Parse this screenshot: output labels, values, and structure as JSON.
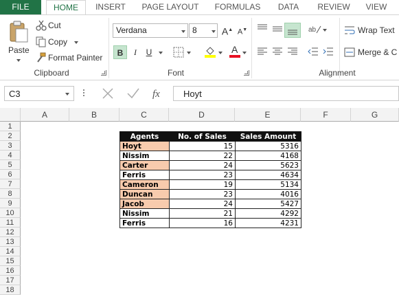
{
  "tabs": [
    "FILE",
    "HOME",
    "INSERT",
    "PAGE LAYOUT",
    "FORMULAS",
    "DATA",
    "REVIEW",
    "VIEW"
  ],
  "clipboard": {
    "paste": "Paste",
    "cut": "Cut",
    "copy": "Copy",
    "format_painter": "Format Painter",
    "label": "Clipboard"
  },
  "font": {
    "name": "Verdana",
    "size": "8",
    "label": "Font",
    "bold": "B",
    "italic": "I",
    "underline": "U"
  },
  "alignment": {
    "wrap_text": "Wrap Text",
    "merge_center": "Merge & C",
    "label": "Alignment"
  },
  "formula_bar": {
    "name_box": "C3",
    "value": "Hoyt"
  },
  "columns": [
    "A",
    "B",
    "C",
    "D",
    "E",
    "F",
    "G"
  ],
  "rows": [
    "1",
    "2",
    "3",
    "4",
    "5",
    "6",
    "7",
    "8",
    "9",
    "10",
    "11",
    "12",
    "13",
    "14",
    "15",
    "16",
    "17",
    "18"
  ],
  "table": {
    "headers": [
      "Agents",
      "No. of Sales",
      "Sales Amount"
    ],
    "rows": [
      {
        "agent": "Hoyt",
        "sales": "15",
        "amount": "5316",
        "highlight": true
      },
      {
        "agent": "Nissim",
        "sales": "22",
        "amount": "4168",
        "highlight": false
      },
      {
        "agent": "Carter",
        "sales": "24",
        "amount": "5623",
        "highlight": true
      },
      {
        "agent": "Ferris",
        "sales": "23",
        "amount": "4634",
        "highlight": false
      },
      {
        "agent": "Cameron",
        "sales": "19",
        "amount": "5134",
        "highlight": true
      },
      {
        "agent": "Duncan",
        "sales": "23",
        "amount": "4016",
        "highlight": true
      },
      {
        "agent": "Jacob",
        "sales": "24",
        "amount": "5427",
        "highlight": true
      },
      {
        "agent": "Nissim",
        "sales": "21",
        "amount": "4292",
        "highlight": false
      },
      {
        "agent": "Ferris",
        "sales": "16",
        "amount": "4231",
        "highlight": false
      }
    ]
  },
  "colors": {
    "file_tab": "#217346",
    "highlight": "#f8cbad",
    "header_bg": "#111111"
  }
}
